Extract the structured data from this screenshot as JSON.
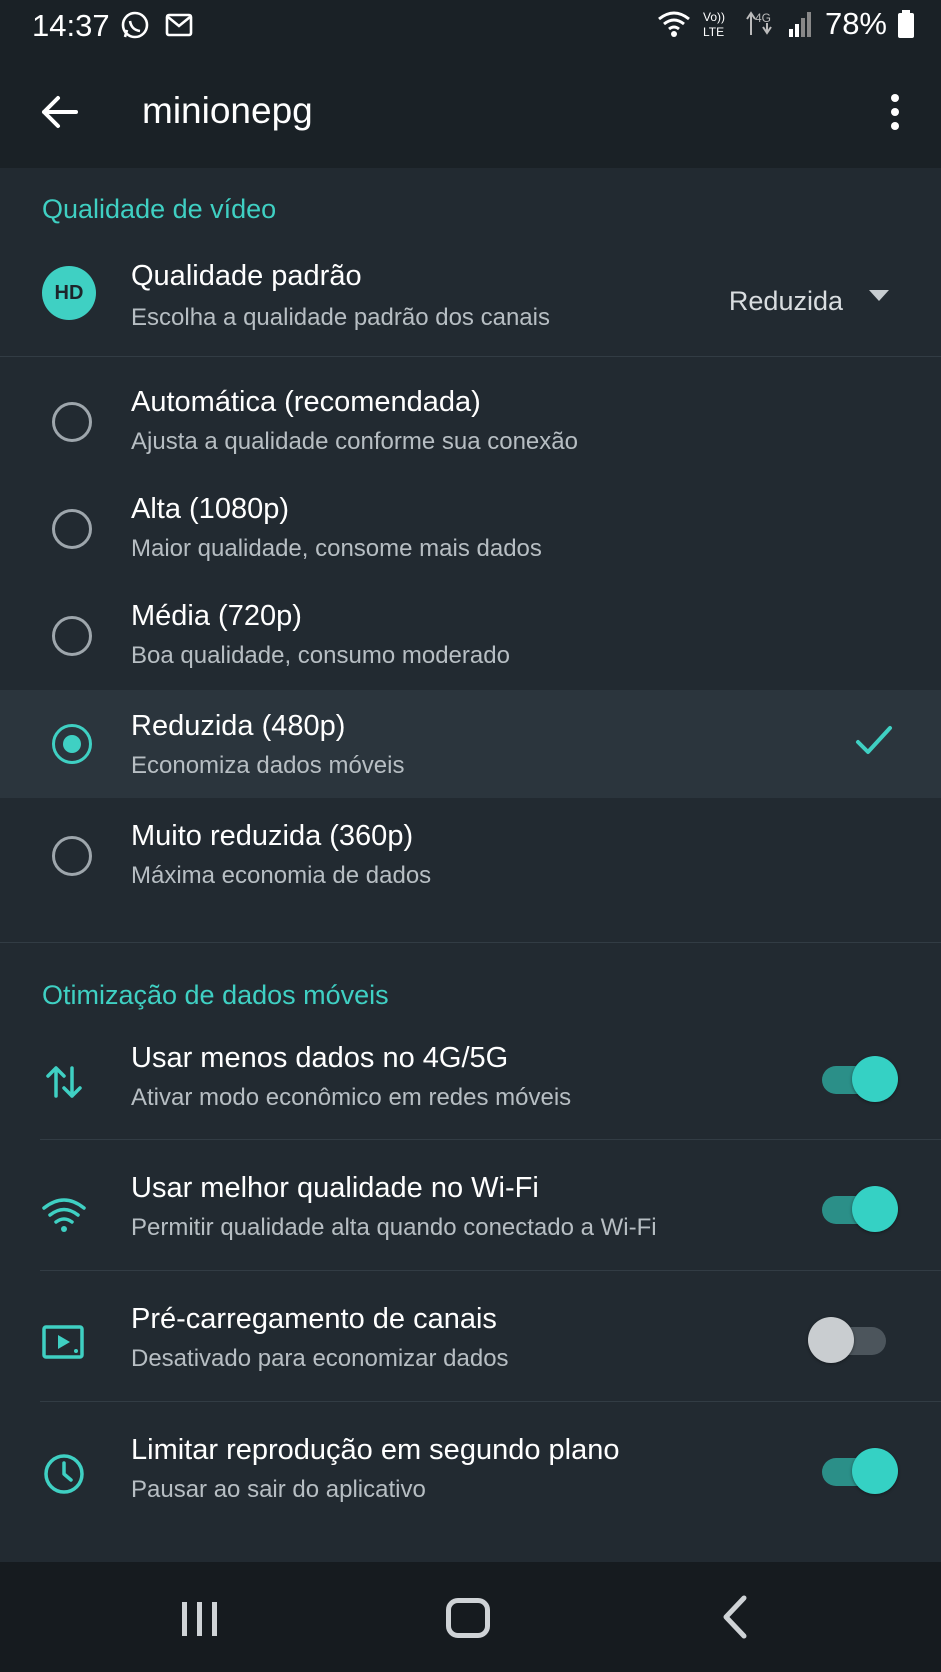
{
  "status_bar": {
    "time": "14:37",
    "battery": "78%",
    "icons": [
      "whatsapp-icon",
      "gmail-icon",
      "wifi-icon",
      "volte-icon",
      "data-4g-icon",
      "signal-icon",
      "battery-icon"
    ],
    "volte_label_top": "Vo))",
    "volte_label_bottom": "LTE",
    "data_label": "4G"
  },
  "app_bar": {
    "title": "minionepg"
  },
  "video_quality": {
    "section_title": "Qualidade de vídeo",
    "badge": "HD",
    "default_title": "Qualidade padrão",
    "default_subtitle": "Escolha a qualidade padrão dos canais",
    "default_value": "Reduzida",
    "options": [
      {
        "title": "Automática (recomendada)",
        "subtitle": "Ajusta a qualidade conforme sua conexão",
        "selected": false
      },
      {
        "title": "Alta (1080p)",
        "subtitle": "Maior qualidade, consome mais dados",
        "selected": false
      },
      {
        "title": "Média (720p)",
        "subtitle": "Boa qualidade, consumo moderado",
        "selected": false
      },
      {
        "title": "Reduzida (480p)",
        "subtitle": "Economiza dados móveis",
        "selected": true
      },
      {
        "title": "Muito reduzida (360p)",
        "subtitle": "Máxima economia de dados",
        "selected": false
      }
    ]
  },
  "data_optimization": {
    "section_title": "Otimização de dados móveis",
    "items": [
      {
        "title": "Usar menos dados no 4G/5G",
        "subtitle": "Ativar modo econômico em redes móveis",
        "icon": "data-transfer-icon",
        "enabled": true
      },
      {
        "title": "Usar melhor qualidade no Wi-Fi",
        "subtitle": "Permitir qualidade alta quando conectado a Wi-Fi",
        "icon": "wifi-icon",
        "enabled": true
      },
      {
        "title": "Pré-carregamento de canais",
        "subtitle": "Desativado para economizar dados",
        "icon": "play-preload-icon",
        "enabled": false
      },
      {
        "title": "Limitar reprodução em segundo plano",
        "subtitle": "Pausar ao sair do aplicativo",
        "icon": "clock-icon",
        "enabled": true
      }
    ]
  },
  "colors": {
    "accent": "#3fd0c3",
    "background": "#222a31",
    "app_bar": "#1a2126",
    "selected_row": "#2b353d"
  }
}
